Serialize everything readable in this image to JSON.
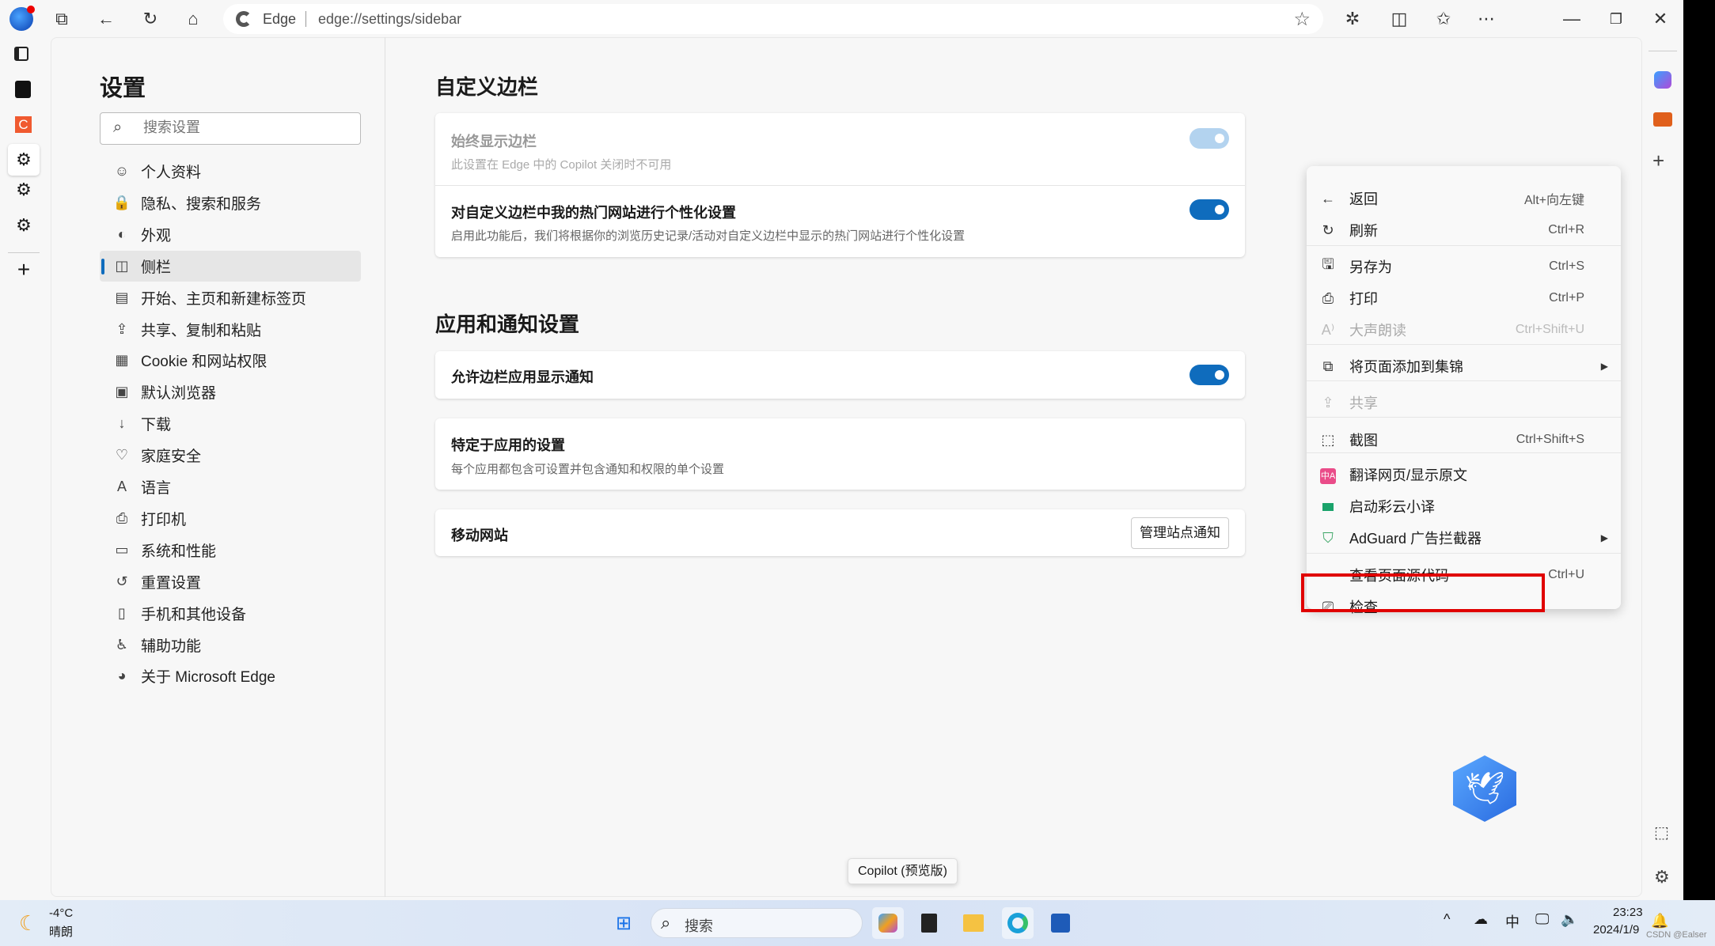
{
  "browser": {
    "address_prefix": "Edge",
    "address_url": "edge://settings/sidebar"
  },
  "settings": {
    "title": "设置",
    "search_placeholder": "搜索设置",
    "nav": [
      {
        "label": "个人资料",
        "icon": "profile-icon"
      },
      {
        "label": "隐私、搜索和服务",
        "icon": "lock-icon"
      },
      {
        "label": "外观",
        "icon": "appearance-icon"
      },
      {
        "label": "侧栏",
        "icon": "sidebar-icon",
        "selected": true
      },
      {
        "label": "开始、主页和新建标签页",
        "icon": "home-icon"
      },
      {
        "label": "共享、复制和粘贴",
        "icon": "share-icon"
      },
      {
        "label": "Cookie 和网站权限",
        "icon": "cookie-icon"
      },
      {
        "label": "默认浏览器",
        "icon": "browser-icon"
      },
      {
        "label": "下载",
        "icon": "download-icon"
      },
      {
        "label": "家庭安全",
        "icon": "family-icon"
      },
      {
        "label": "语言",
        "icon": "language-icon"
      },
      {
        "label": "打印机",
        "icon": "printer-icon"
      },
      {
        "label": "系统和性能",
        "icon": "laptop-icon"
      },
      {
        "label": "重置设置",
        "icon": "reset-icon"
      },
      {
        "label": "手机和其他设备",
        "icon": "phone-icon"
      },
      {
        "label": "辅助功能",
        "icon": "accessibility-icon"
      },
      {
        "label": "关于 Microsoft Edge",
        "icon": "edge-icon"
      }
    ]
  },
  "main": {
    "section1": "自定义边栏",
    "always_show": {
      "title": "始终显示边栏",
      "desc": "此设置在 Edge 中的 Copilot 关闭时不可用",
      "on": true,
      "disabled": true
    },
    "personalize": {
      "title": "对自定义边栏中我的热门网站进行个性化设置",
      "desc": "启用此功能后，我们将根据你的浏览历史记录/活动对自定义边栏中显示的热门网站进行个性化设置",
      "on": true
    },
    "section2": "应用和通知设置",
    "allow_notify": {
      "title": "允许边栏应用显示通知",
      "on": true
    },
    "app_specific": {
      "title": "特定于应用的设置",
      "desc": "每个应用都包含可设置并包含通知和权限的单个设置"
    },
    "mobile": {
      "title": "移动网站",
      "button": "管理站点通知"
    }
  },
  "context_menu": [
    {
      "label": "返回",
      "shortcut": "Alt+向左键",
      "icon": "back-arrow-icon"
    },
    {
      "label": "刷新",
      "shortcut": "Ctrl+R",
      "icon": "refresh-icon"
    },
    {
      "label": "另存为",
      "shortcut": "Ctrl+S",
      "icon": "save-as-icon"
    },
    {
      "label": "打印",
      "shortcut": "Ctrl+P",
      "icon": "print-icon"
    },
    {
      "label": "大声朗读",
      "shortcut": "Ctrl+Shift+U",
      "icon": "read-aloud-icon",
      "disabled": true
    },
    {
      "label": "将页面添加到集锦",
      "icon": "collections-icon",
      "submenu": true
    },
    {
      "label": "共享",
      "icon": "share-icon",
      "disabled": true
    },
    {
      "label": "截图",
      "shortcut": "Ctrl+Shift+S",
      "icon": "screenshot-icon"
    },
    {
      "label": "翻译网页/显示原文",
      "icon": "translate-icon"
    },
    {
      "label": "启动彩云小译",
      "icon": "caiyun-icon"
    },
    {
      "label": "AdGuard 广告拦截器",
      "icon": "adguard-shield-icon",
      "submenu": true
    },
    {
      "label": "查看页面源代码",
      "shortcut": "Ctrl+U"
    },
    {
      "label": "检查",
      "icon": "inspect-icon",
      "highlighted": true
    }
  ],
  "tooltip": "Copilot (预览版)",
  "taskbar": {
    "temp": "-4°C",
    "weather": "晴朗",
    "search": "搜索",
    "time": "23:23",
    "date": "2024/1/9",
    "ime": "中"
  },
  "watermark": "CSDN @Ealser",
  "colors": {
    "accent": "#0f6cbd",
    "highlight_box": "#e00000"
  }
}
